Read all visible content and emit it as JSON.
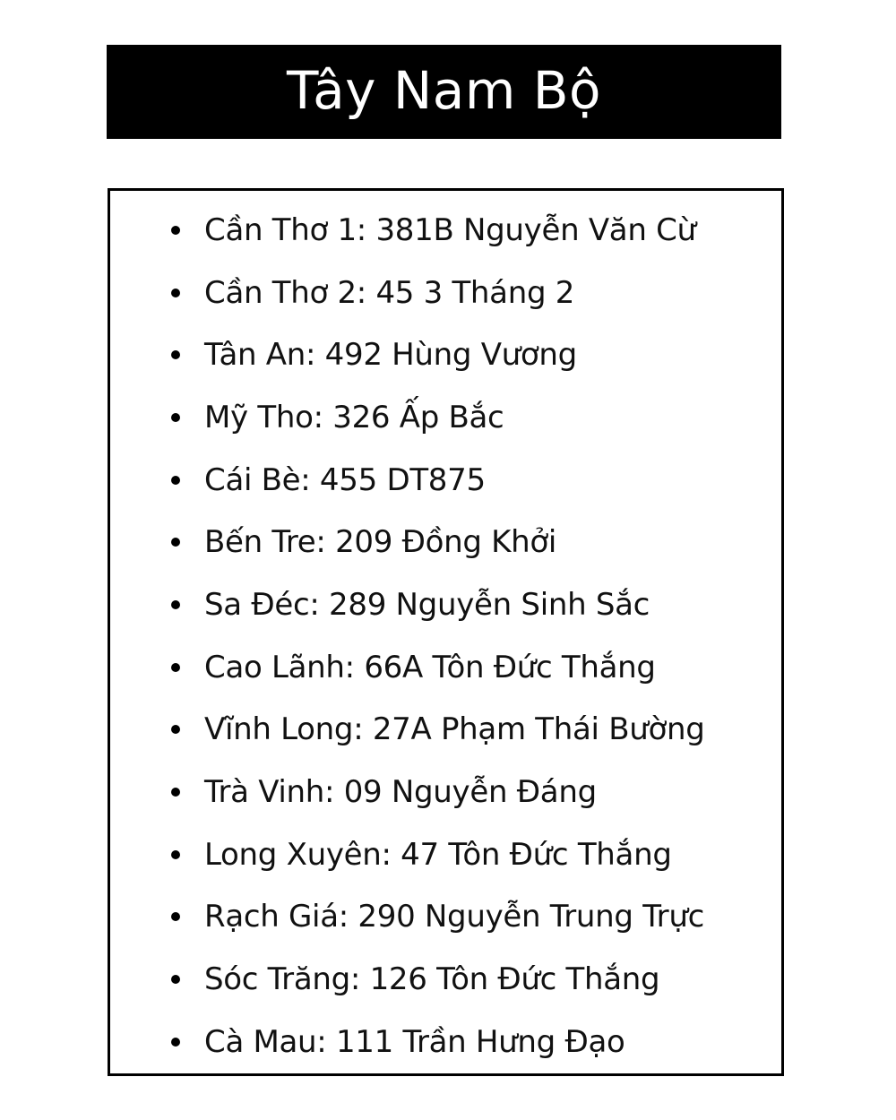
{
  "header": {
    "title": "Tây Nam Bộ"
  },
  "branches": [
    "Cần Thơ 1: 381B Nguyễn Văn Cừ",
    "Cần Thơ 2: 45 3 Tháng 2",
    "Tân An: 492 Hùng Vương",
    "Mỹ Tho: 326 Ấp Bắc",
    "Cái Bè: 455 DT875",
    "Bến Tre: 209 Đồng Khởi",
    "Sa Đéc: 289 Nguyễn Sinh Sắc",
    "Cao Lãnh: 66A Tôn Đức Thắng",
    "Vĩnh Long: 27A Phạm Thái Bường",
    "Trà Vinh: 09 Nguyễn Đáng",
    "Long Xuyên: 47 Tôn Đức Thắng",
    "Rạch Giá: 290 Nguyễn Trung Trực",
    "Sóc Trăng: 126 Tôn Đức Thắng",
    "Cà Mau: 111 Trần Hưng Đạo"
  ],
  "colors": {
    "title_background": "#000000",
    "title_text": "#ffffff",
    "border": "#000000",
    "text": "#111111"
  }
}
